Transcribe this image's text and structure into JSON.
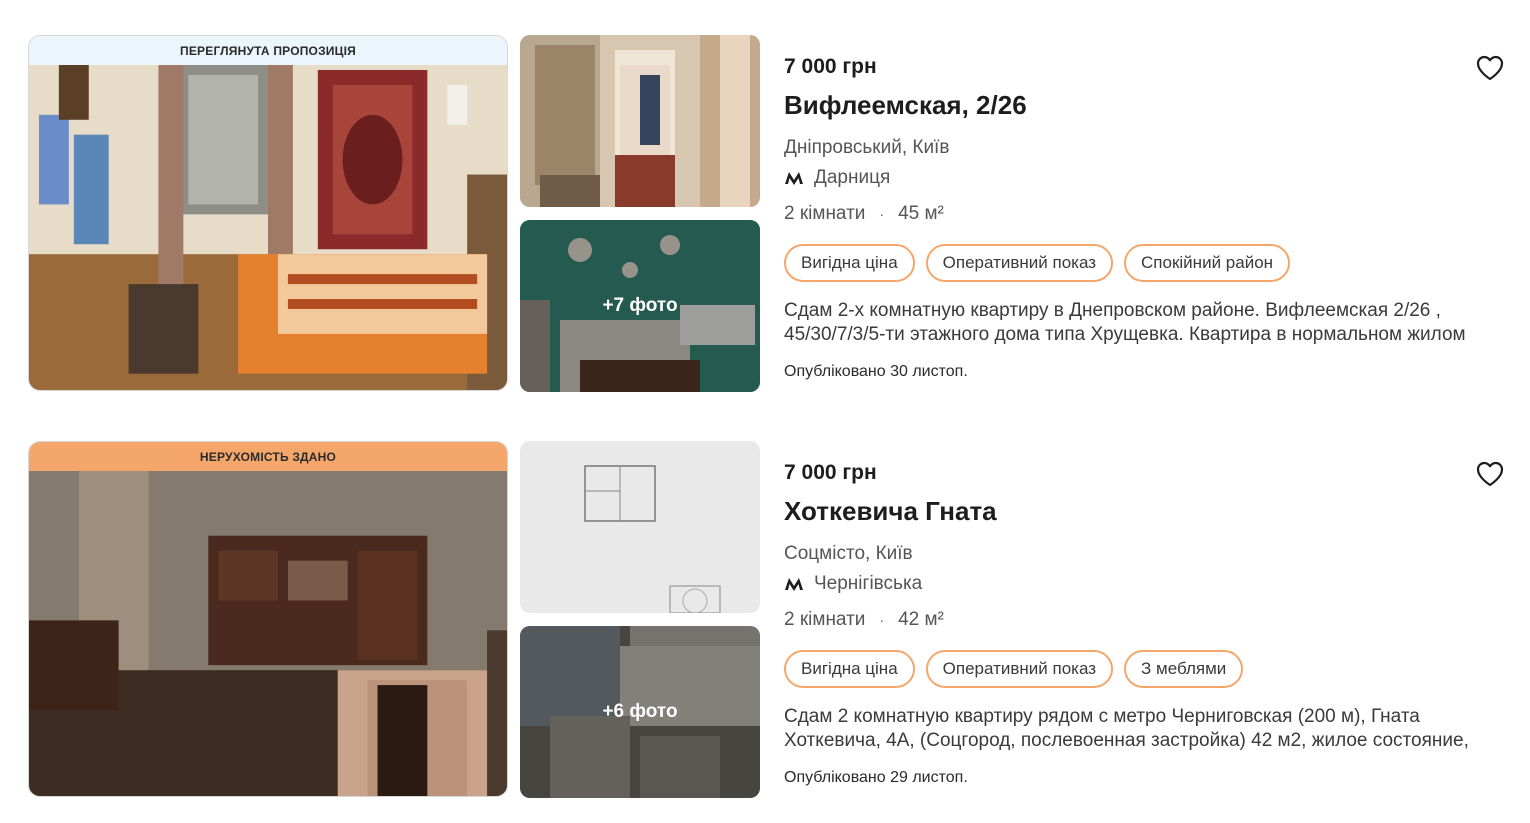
{
  "listings": [
    {
      "banner": "ПЕРЕГЛЯНУТА ПРОПОЗИЦІЯ",
      "more_photos": "+7 фото",
      "price": "7 000 грн",
      "title": "Вифлеемская, 2/26",
      "district": "Дніпровський, Київ",
      "metro": "Дарниця",
      "rooms": "2 кімнати",
      "area": "45 м²",
      "tags": [
        "Вигідна ціна",
        "Оперативний показ",
        "Спокійний район"
      ],
      "description": "Сдам 2-х комнатную квартиру в Днепровском районе. Вифлеемская 2/26 , 45/30/7/3/5-ти этажного дома типа Хрущевка. Квартира в нормальном жилом",
      "published": "Опубліковано 30 листоп."
    },
    {
      "banner": "НЕРУХОМІСТЬ ЗДАНО",
      "more_photos": "+6 фото",
      "price": "7 000 грн",
      "title": "Хоткевича Гната",
      "district": "Соцмісто, Київ",
      "metro": "Чернігівська",
      "rooms": "2 кімнати",
      "area": "42 м²",
      "tags": [
        "Вигідна ціна",
        "Оперативний показ",
        "З меблями"
      ],
      "description": "Сдам 2 комнатную квартиру рядом с метро Черниговская (200 м), Гната Хоткевича, 4А, (Соцгород, послевоенная застройка) 42 м2, жилое состояние,",
      "published": "Опубліковано 29 листоп."
    }
  ],
  "colors": {
    "accent": "#f5a66b",
    "seen_banner": "#eaf6fb",
    "text": "#1d1d1d",
    "muted": "#555555"
  }
}
